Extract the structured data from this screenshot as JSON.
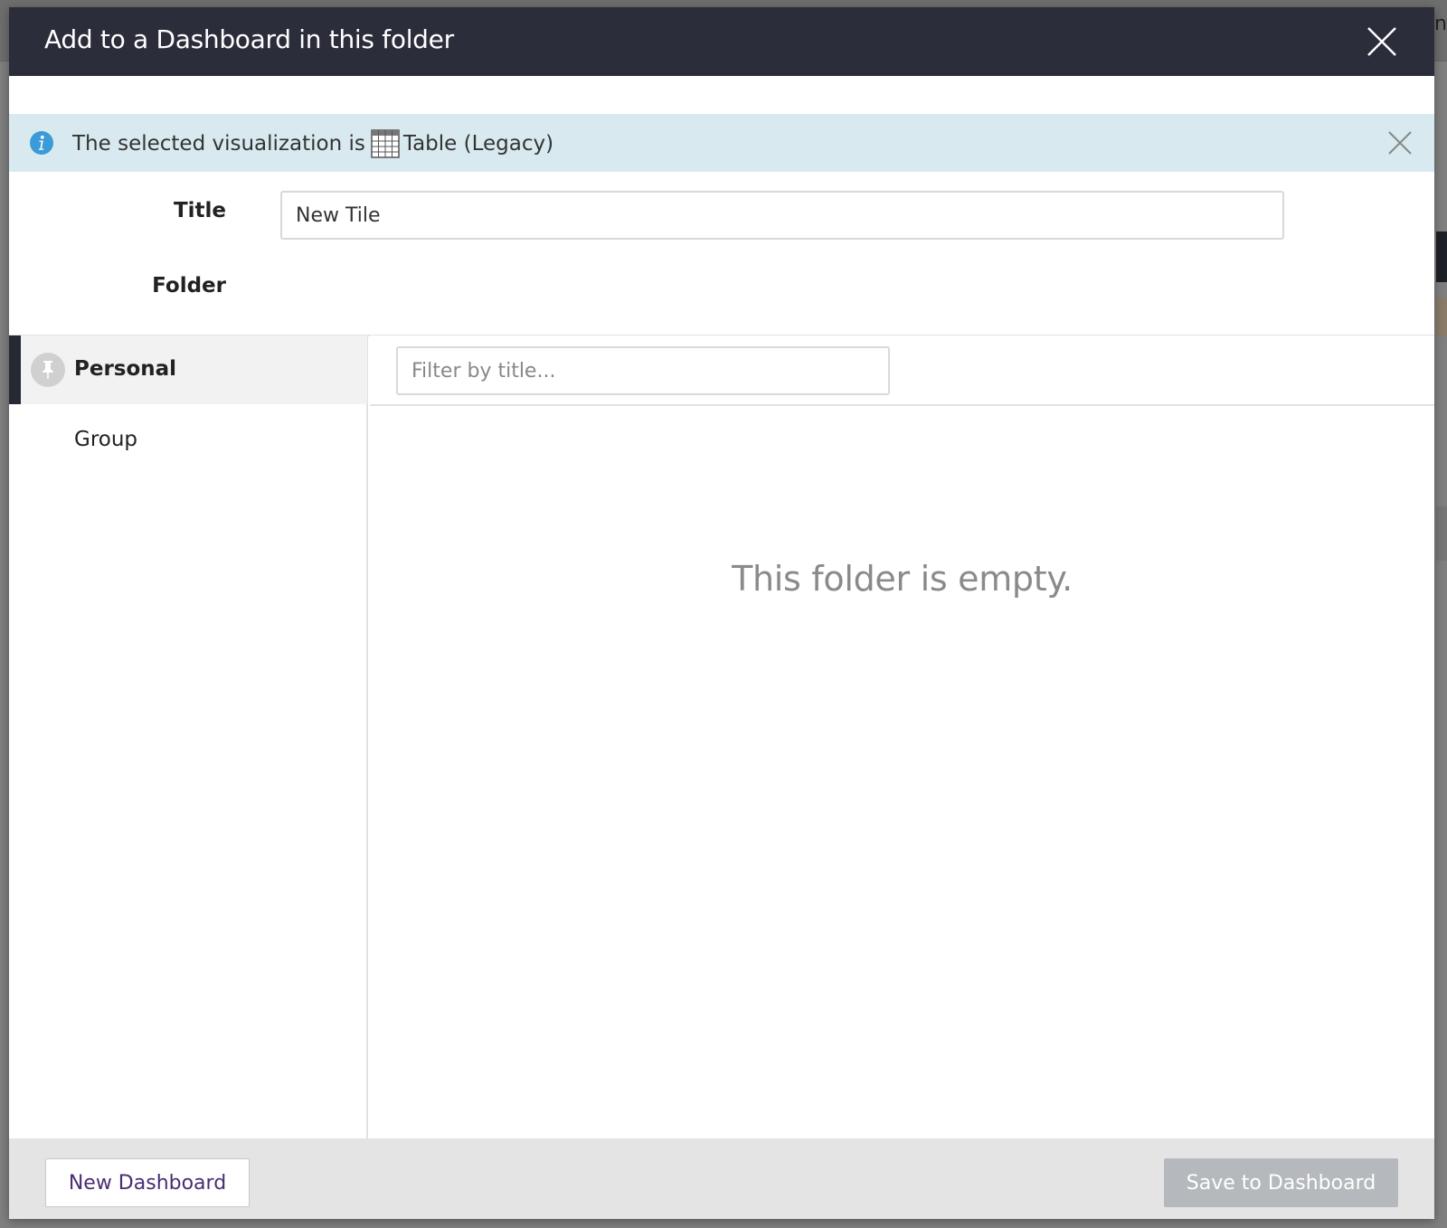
{
  "background": {
    "edge_text": "n"
  },
  "modal": {
    "title": "Add to a Dashboard in this folder",
    "close_icon": "close-icon"
  },
  "info_banner": {
    "text_prefix": "The selected visualization is",
    "visualization_name": "Table (Legacy)",
    "icon": "info-icon",
    "viz_icon": "table-icon",
    "close_icon": "close-icon"
  },
  "form": {
    "title_label": "Title",
    "title_value": "New Tile",
    "folder_label": "Folder"
  },
  "folders": {
    "items": [
      {
        "label": "Personal",
        "active": true,
        "icon": "pin-icon"
      },
      {
        "label": "Group",
        "active": false
      }
    ]
  },
  "filter": {
    "placeholder": "Filter by title..."
  },
  "content": {
    "empty_message": "This folder is empty."
  },
  "footer": {
    "new_dashboard_label": "New Dashboard",
    "save_label": "Save to Dashboard"
  },
  "colors": {
    "header_bg": "#2b2d3a",
    "banner_bg": "#d8eaef",
    "info_blue": "#3a9bd8",
    "active_bar": "#262833",
    "link_purple": "#4a2d73",
    "disabled_button": "#b5b9bd"
  }
}
